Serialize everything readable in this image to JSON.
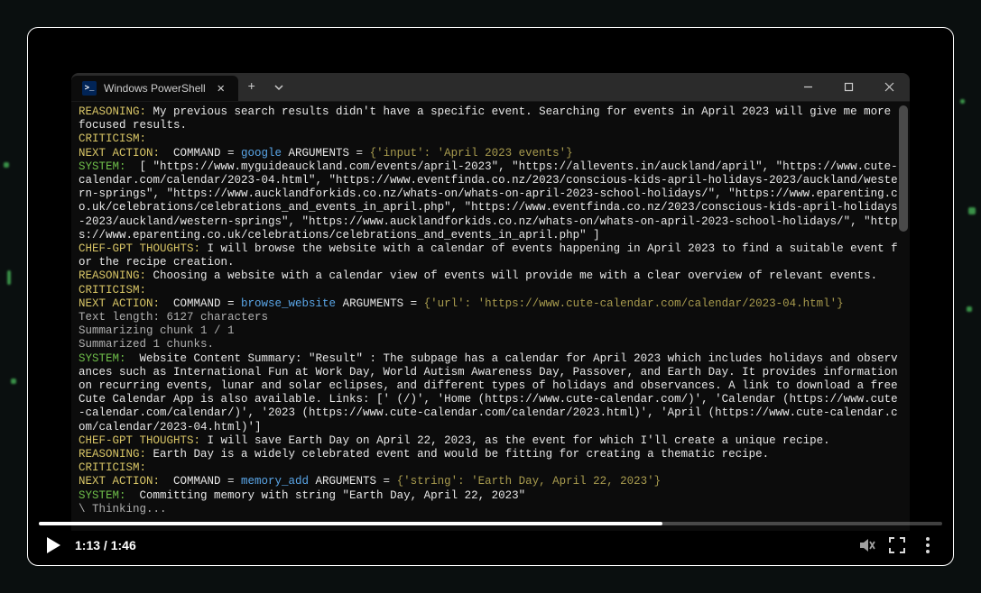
{
  "window": {
    "tab_title": "Windows PowerShell"
  },
  "video": {
    "current_time": "1:13",
    "duration": "1:46",
    "progress_percent": 69
  },
  "terminal": {
    "lines": [
      {
        "segments": [
          {
            "c": "yellow",
            "t": "REASONING:"
          },
          {
            "c": "white",
            "t": " My previous search results didn't have a specific event. Searching for events in April 2023 will give me more focused results."
          }
        ]
      },
      {
        "segments": [
          {
            "c": "yellow",
            "t": "CRITICISM:"
          }
        ]
      },
      {
        "segments": [
          {
            "c": "yellow",
            "t": "NEXT ACTION:"
          },
          {
            "c": "white",
            "t": "  COMMAND = "
          },
          {
            "c": "blue",
            "t": "google"
          },
          {
            "c": "white",
            "t": " ARGUMENTS = "
          },
          {
            "c": "olive",
            "t": "{'input': 'April 2023 events'}"
          }
        ]
      },
      {
        "segments": [
          {
            "c": "green",
            "t": "SYSTEM:"
          },
          {
            "c": "white",
            "t": "  [ \"https://www.myguideauckland.com/events/april-2023\", \"https://allevents.in/auckland/april\", \"https://www.cute-calendar.com/calendar/2023-04.html\", \"https://www.eventfinda.co.nz/2023/conscious-kids-april-holidays-2023/auckland/western-springs\", \"https://www.aucklandforkids.co.nz/whats-on/whats-on-april-2023-school-holidays/\", \"https://www.eparenting.co.uk/celebrations/celebrations_and_events_in_april.php\", \"https://www.eventfinda.co.nz/2023/conscious-kids-april-holidays-2023/auckland/western-springs\", \"https://www.aucklandforkids.co.nz/whats-on/whats-on-april-2023-school-holidays/\", \"https://www.eparenting.co.uk/celebrations/celebrations_and_events_in_april.php\" ]"
          }
        ]
      },
      {
        "segments": [
          {
            "c": "yellow",
            "t": "CHEF-GPT THOUGHTS:"
          },
          {
            "c": "white",
            "t": " I will browse the website with a calendar of events happening in April 2023 to find a suitable event for the recipe creation."
          }
        ]
      },
      {
        "segments": [
          {
            "c": "yellow",
            "t": "REASONING:"
          },
          {
            "c": "white",
            "t": " Choosing a website with a calendar view of events will provide me with a clear overview of relevant events."
          }
        ]
      },
      {
        "segments": [
          {
            "c": "yellow",
            "t": "CRITICISM:"
          }
        ]
      },
      {
        "segments": [
          {
            "c": "yellow",
            "t": "NEXT ACTION:"
          },
          {
            "c": "white",
            "t": "  COMMAND = "
          },
          {
            "c": "blue",
            "t": "browse_website"
          },
          {
            "c": "white",
            "t": " ARGUMENTS = "
          },
          {
            "c": "olive",
            "t": "{'url': 'https://www.cute-calendar.com/calendar/2023-04.html'}"
          }
        ]
      },
      {
        "segments": [
          {
            "c": "grey",
            "t": "Text length: 6127 characters"
          }
        ]
      },
      {
        "segments": [
          {
            "c": "grey",
            "t": "Summarizing chunk 1 / 1"
          }
        ]
      },
      {
        "segments": [
          {
            "c": "grey",
            "t": "Summarized 1 chunks."
          }
        ]
      },
      {
        "segments": [
          {
            "c": "green",
            "t": "SYSTEM:"
          },
          {
            "c": "white",
            "t": "  Website Content Summary: \"Result\" : The subpage has a calendar for April 2023 which includes holidays and observances such as International Fun at Work Day, World Autism Awareness Day, Passover, and Earth Day. It provides information on recurring events, lunar and solar eclipses, and different types of holidays and observances. A link to download a free Cute Calendar App is also available. Links: [' (/)', 'Home (https://www.cute-calendar.com/)', 'Calendar (https://www.cute-calendar.com/calendar/)', '2023 (https://www.cute-calendar.com/calendar/2023.html)', 'April (https://www.cute-calendar.com/calendar/2023-04.html)']"
          }
        ]
      },
      {
        "segments": [
          {
            "c": "yellow",
            "t": "CHEF-GPT THOUGHTS:"
          },
          {
            "c": "white",
            "t": " I will save Earth Day on April 22, 2023, as the event for which I'll create a unique recipe."
          }
        ]
      },
      {
        "segments": [
          {
            "c": "yellow",
            "t": "REASONING:"
          },
          {
            "c": "white",
            "t": " Earth Day is a widely celebrated event and would be fitting for creating a thematic recipe."
          }
        ]
      },
      {
        "segments": [
          {
            "c": "yellow",
            "t": "CRITICISM:"
          }
        ]
      },
      {
        "segments": [
          {
            "c": "yellow",
            "t": "NEXT ACTION:"
          },
          {
            "c": "white",
            "t": "  COMMAND = "
          },
          {
            "c": "blue",
            "t": "memory_add"
          },
          {
            "c": "white",
            "t": " ARGUMENTS = "
          },
          {
            "c": "olive",
            "t": "{'string': 'Earth Day, April 22, 2023'}"
          }
        ]
      },
      {
        "segments": [
          {
            "c": "green",
            "t": "SYSTEM:"
          },
          {
            "c": "white",
            "t": "  Committing memory with string \"Earth Day, April 22, 2023\""
          }
        ]
      },
      {
        "segments": [
          {
            "c": "grey",
            "t": "\\ Thinking..."
          }
        ]
      }
    ]
  }
}
